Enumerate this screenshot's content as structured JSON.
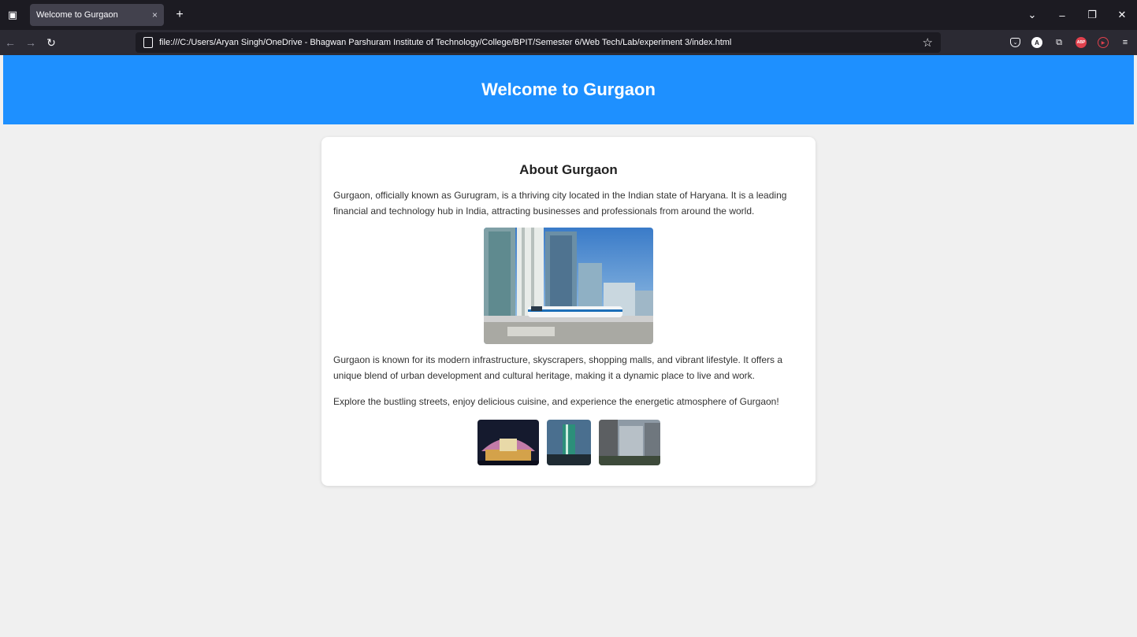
{
  "browser": {
    "tab_title": "Welcome to Gurgaon",
    "tab_close": "×",
    "new_tab": "+",
    "url": "file:///C:/Users/Aryan Singh/OneDrive - Bhagwan Parshuram Institute of Technology/College/BPIT/Semester 6/Web Tech/Lab/experiment 3/index.html"
  },
  "header": {
    "title": "Welcome to Gurgaon"
  },
  "content": {
    "heading": "About Gurgaon",
    "paragraph1": "Gurgaon, officially known as Gurugram, is a thriving city located in the Indian state of Haryana. It is a leading financial and technology hub in India, attracting businesses and professionals from around the world.",
    "paragraph2": "Gurgaon is known for its modern infrastructure, skyscrapers, shopping malls, and vibrant lifestyle. It offers a unique blend of urban development and cultural heritage, making it a dynamic place to live and work.",
    "paragraph3": "Explore the bustling streets, enjoy delicious cuisine, and experience the energetic atmosphere of Gurgaon!"
  },
  "colors": {
    "header_bg": "#1e90ff",
    "page_bg": "#f0f0f0",
    "card_bg": "#ffffff"
  }
}
